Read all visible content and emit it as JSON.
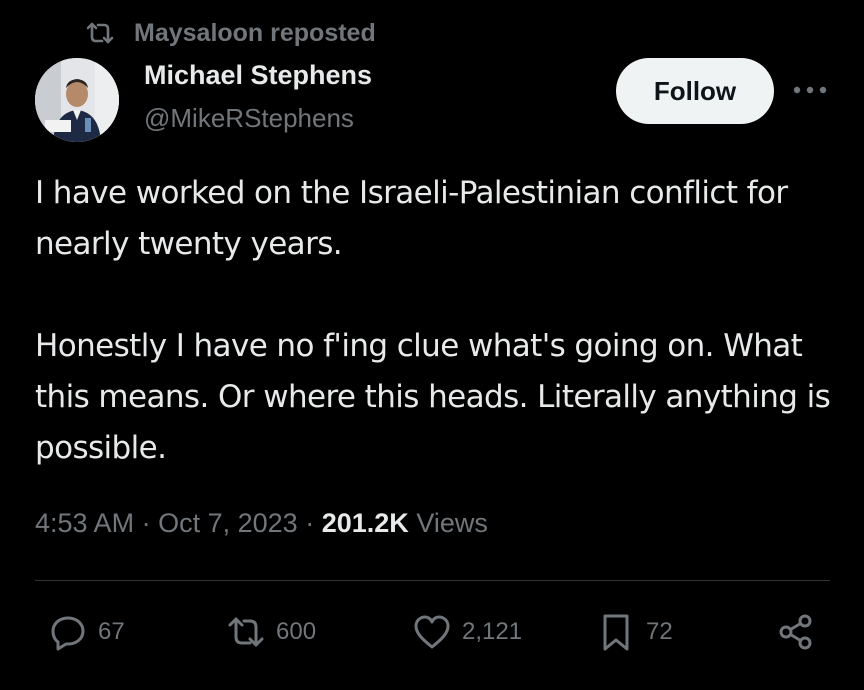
{
  "repost": {
    "label": "Maysaloon reposted",
    "icon": "repost-icon"
  },
  "author": {
    "name": "Michael Stephens",
    "handle": "@MikeRStephens",
    "avatar_icon": "avatar-photo"
  },
  "follow_button": {
    "label": "Follow"
  },
  "more_button": {
    "icon": "more-dots-icon"
  },
  "tweet": {
    "paragraphs": [
      "I have worked on the Israeli-Palestinian conflict for nearly twenty years.",
      "Honestly I have no f'ing clue what's going on. What this means. Or where this heads. Literally anything is possible."
    ]
  },
  "meta": {
    "time": "4:53 AM",
    "separator": "·",
    "date": "Oct 7, 2023",
    "views_count": "201.2K",
    "views_label": "Views"
  },
  "actions": {
    "replies": "67",
    "reposts": "600",
    "likes": "2,121",
    "bookmarks": "72"
  },
  "colors": {
    "background": "#000000",
    "text": "#e7e9ea",
    "muted": "#71767b",
    "divider": "#2f3336",
    "follow_bg": "#eff3f4"
  }
}
